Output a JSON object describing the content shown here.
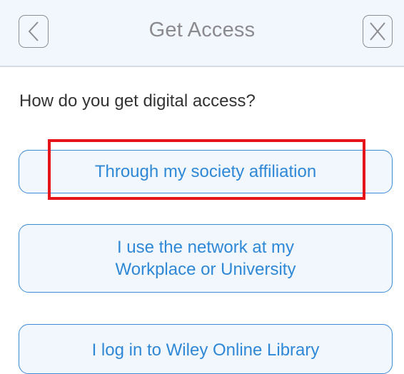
{
  "header": {
    "title": "Get Access",
    "back_icon": "chevron-left-icon",
    "close_icon": "close-icon"
  },
  "question": "How do you get digital access?",
  "options": [
    {
      "label": "Through my society affiliation"
    },
    {
      "line1": "I use the network at my",
      "line2": "Workplace or University"
    },
    {
      "label": "I log in to Wiley Online Library"
    }
  ],
  "colors": {
    "accent": "#2f88d6",
    "header_bg": "#f2f7fd",
    "highlight": "#e5141a"
  }
}
